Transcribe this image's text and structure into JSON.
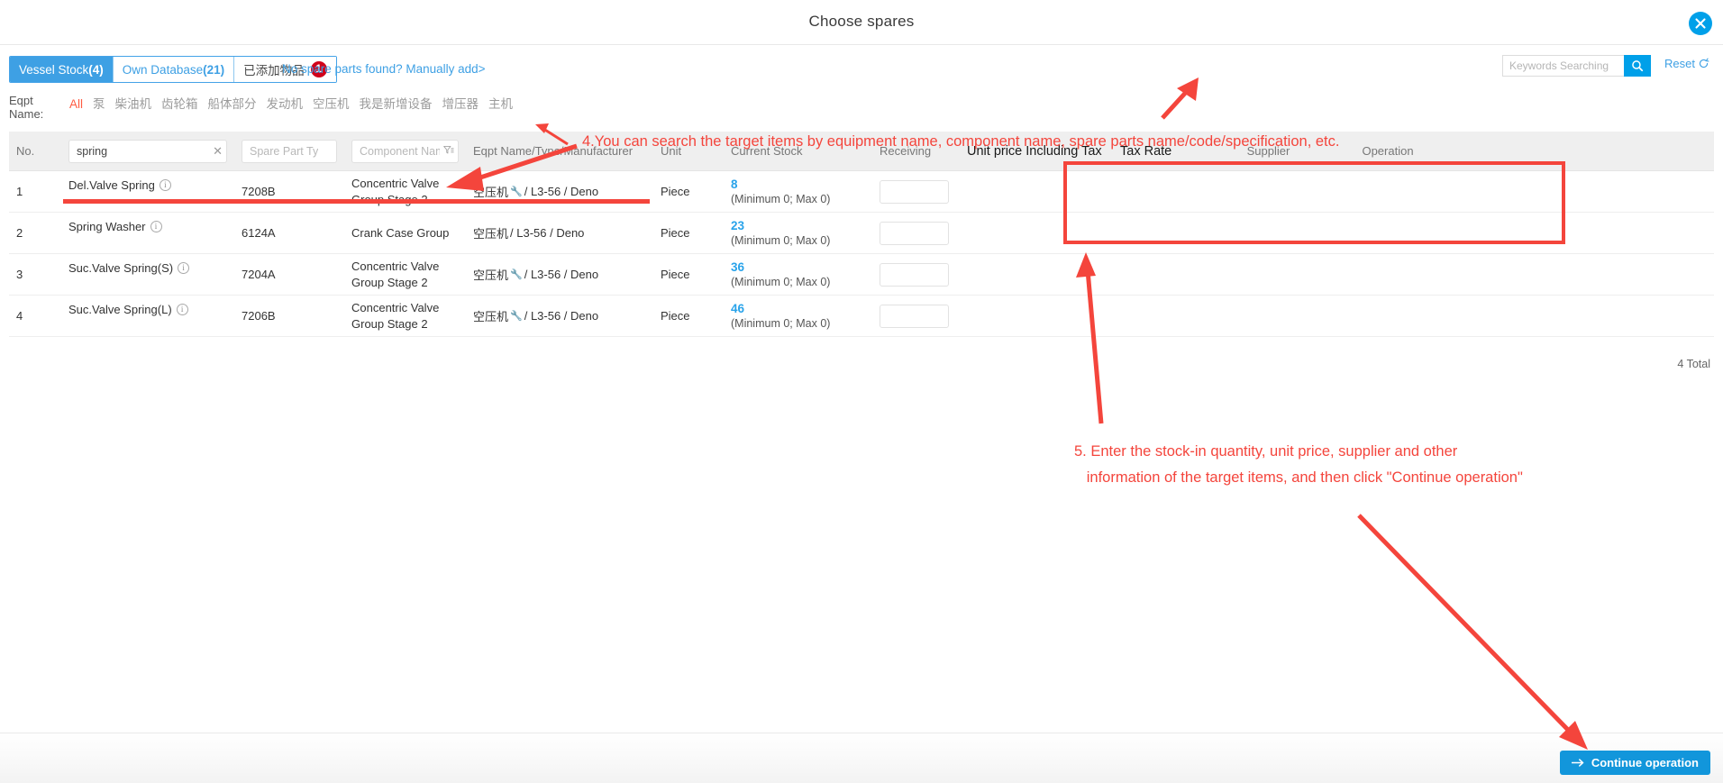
{
  "window": {
    "title": "Choose spares",
    "close_icon": "close-circle-icon"
  },
  "tabs": [
    {
      "label": "Vessel Stock",
      "count": "(4)",
      "active": true
    },
    {
      "label": "Own Database",
      "count": "(21)",
      "active": false
    },
    {
      "label": "已添加物品",
      "badge": "1",
      "active": false
    }
  ],
  "manual_add_link": "No spare parts found? Manually add>",
  "search": {
    "placeholder": "Keywords Searching",
    "value": "",
    "icon": "search-icon",
    "reset_label": "Reset",
    "reset_icon": "refresh-icon"
  },
  "eqpt_filter": {
    "label": "Eqpt\nName:",
    "items": [
      {
        "label": "All",
        "selected": true,
        "dot": false
      },
      {
        "label": "泵",
        "selected": false,
        "dot": false
      },
      {
        "label": "柴油机",
        "selected": false,
        "dot": true
      },
      {
        "label": "齿轮箱",
        "selected": false,
        "dot": false
      },
      {
        "label": "船体部分",
        "selected": false,
        "dot": false
      },
      {
        "label": "发动机",
        "selected": false,
        "dot": false
      },
      {
        "label": "空压机",
        "selected": false,
        "dot": true
      },
      {
        "label": "我是新增设备",
        "selected": false,
        "dot": false
      },
      {
        "label": "增压器",
        "selected": false,
        "dot": false
      },
      {
        "label": "主机",
        "selected": false,
        "dot": false
      }
    ]
  },
  "table": {
    "headers": {
      "no": "No.",
      "name_filter_value": "spring",
      "name_filter_clear": "✕",
      "part_type_placeholder": "Spare Part Type",
      "component_name_placeholder": "Component Name",
      "eqpt": "Eqpt Name/Type/Manufacturer",
      "unit": "Unit",
      "current_stock": "Current Stock",
      "receiving": "Receiving",
      "unit_price": "Unit price Including Tax",
      "tax_rate": "Tax Rate",
      "supplier": "Supplier",
      "operation": "Operation"
    },
    "rows": [
      {
        "no": "1",
        "name": "Del.Valve Spring",
        "part_type": "7208B",
        "component": "Concentric Valve Group Stage 2",
        "eqpt_cn": "空压机",
        "eqpt_rest": "/ L3-56 / Deno",
        "eqpt_has_wrench": true,
        "unit": "Piece",
        "stock": "8",
        "stock_sub": "(Minimum 0; Max 0)",
        "receiving": "",
        "unit_price": "",
        "tax_rate": "",
        "supplier": "",
        "operation": ""
      },
      {
        "no": "2",
        "name": "Spring Washer",
        "part_type": "6124A",
        "component": "Crank Case Group",
        "eqpt_cn": "空压机",
        "eqpt_rest": "/ L3-56 / Deno",
        "eqpt_has_wrench": false,
        "unit": "Piece",
        "stock": "23",
        "stock_sub": "(Minimum 0; Max 0)",
        "receiving": "",
        "unit_price": "",
        "tax_rate": "",
        "supplier": "",
        "operation": ""
      },
      {
        "no": "3",
        "name": "Suc.Valve Spring(S)",
        "part_type": "7204A",
        "component": "Concentric Valve Group Stage 2",
        "eqpt_cn": "空压机",
        "eqpt_rest": "/ L3-56 / Deno",
        "eqpt_has_wrench": true,
        "unit": "Piece",
        "stock": "36",
        "stock_sub": "(Minimum 0; Max 0)",
        "receiving": "",
        "unit_price": "",
        "tax_rate": "",
        "supplier": "",
        "operation": ""
      },
      {
        "no": "4",
        "name": "Suc.Valve Spring(L)",
        "part_type": "7206B",
        "component": "Concentric Valve Group Stage 2",
        "eqpt_cn": "空压机",
        "eqpt_rest": "/ L3-56 / Deno",
        "eqpt_has_wrench": true,
        "unit": "Piece",
        "stock": "46",
        "stock_sub": "(Minimum 0; Max 0)",
        "receiving": "",
        "unit_price": "",
        "tax_rate": "",
        "supplier": "",
        "operation": ""
      }
    ],
    "total": "4 Total"
  },
  "footer": {
    "continue_label": "Continue operation",
    "continue_icon": "arrow-right-icon"
  },
  "annotations": {
    "step4": "4.You can search the target items by equipment name, component name, spare parts name/code/specification, etc.",
    "step5_line1": "5. Enter the stock-in quantity, unit price, supplier and other",
    "step5_line2": "   information of the target items, and then click \"Continue operation\""
  },
  "colors": {
    "accent_blue": "#00a0e9",
    "tab_blue": "#3ea0e4",
    "annotation_red": "#f4453c",
    "badge_red": "#d0021b",
    "selected_orange": "#ff5b42",
    "stock_blue": "#29a3ea"
  }
}
